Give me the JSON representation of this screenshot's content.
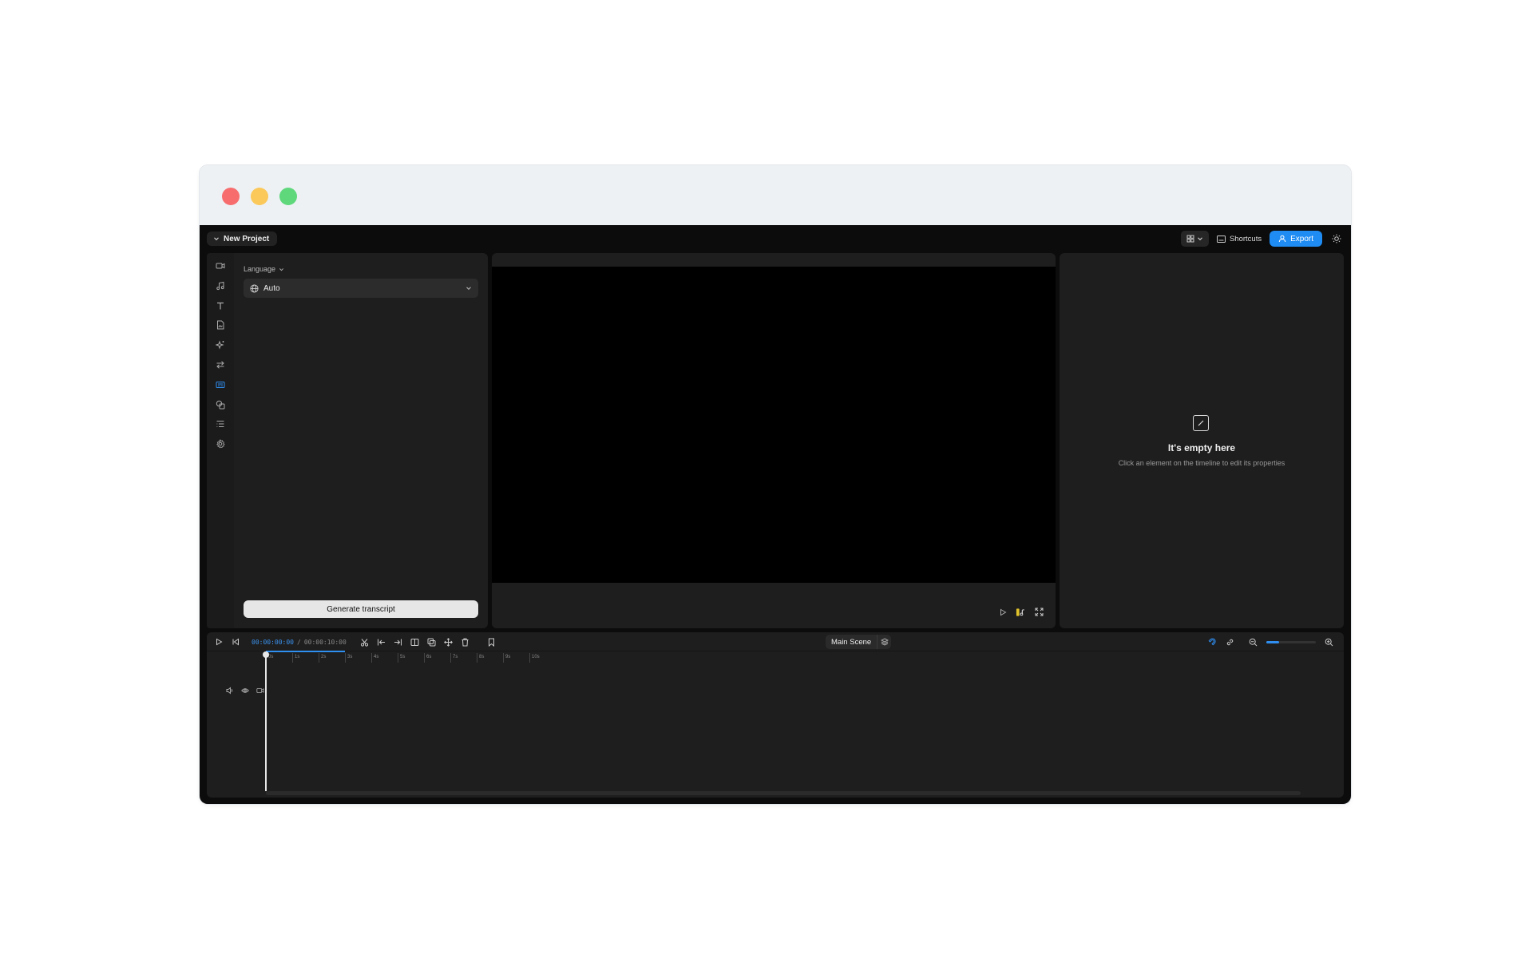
{
  "window": {
    "controls": [
      "close",
      "minimize",
      "maximize"
    ]
  },
  "topbar": {
    "project_name": "New Project",
    "shortcuts_label": "Shortcuts",
    "export_label": "Export",
    "icons": [
      "layout-grid-icon",
      "keyboard-icon",
      "user-icon",
      "sun-icon"
    ]
  },
  "sidebar": {
    "items": [
      {
        "name": "video",
        "icon": "video-icon"
      },
      {
        "name": "audio",
        "icon": "music-icon"
      },
      {
        "name": "text",
        "icon": "text-icon"
      },
      {
        "name": "image",
        "icon": "image-icon"
      },
      {
        "name": "effects",
        "icon": "sparkle-icon"
      },
      {
        "name": "transitions",
        "icon": "transition-icon"
      },
      {
        "name": "captions",
        "icon": "captions-icon",
        "active": true
      },
      {
        "name": "elements",
        "icon": "shapes-icon"
      },
      {
        "name": "templates",
        "icon": "list-icon"
      },
      {
        "name": "settings",
        "icon": "gear-icon"
      }
    ],
    "active_color": "#2f8ef0"
  },
  "left_panel": {
    "language_label": "Language",
    "language_value": "Auto",
    "generate_label": "Generate transcript"
  },
  "props_panel": {
    "empty_title": "It's empty here",
    "empty_subtitle": "Click an element on the timeline to edit its properties"
  },
  "timeline": {
    "current_time": "00:00:00:00",
    "separator": "/",
    "total_time": "00:00:10:00",
    "scene_label": "Main Scene",
    "ruler_labels": [
      "0s",
      "1s",
      "2s",
      "3s",
      "4s",
      "5s",
      "6s",
      "7s",
      "8s",
      "9s",
      "10s"
    ],
    "zoom_level": 0.25,
    "progress_seconds": 3
  },
  "colors": {
    "accent": "#1f8cf3",
    "background": "#0c0c0c",
    "panel": "#1e1e1e"
  }
}
